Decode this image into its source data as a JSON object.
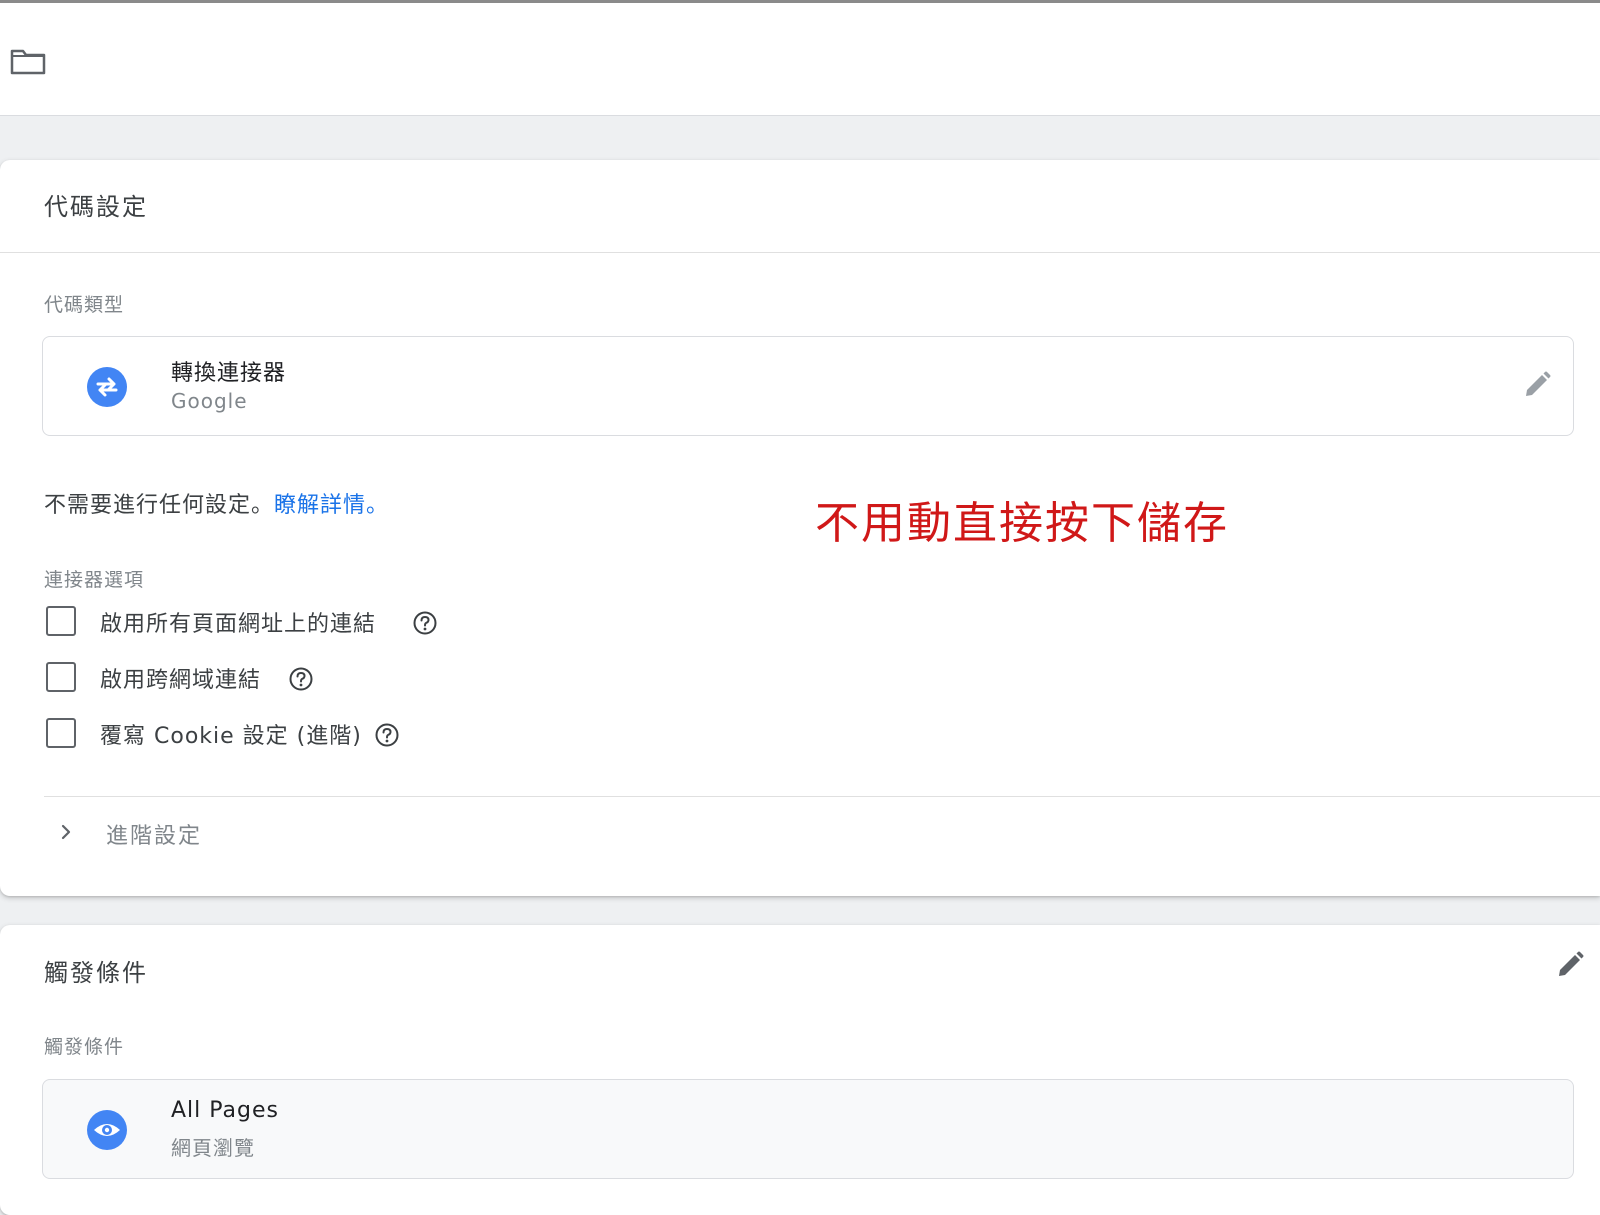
{
  "topbar": {
    "icon": "folder-icon"
  },
  "tag_config": {
    "title": "代碼設定",
    "type_label": "代碼類型",
    "tag_type": {
      "name": "轉換連接器",
      "vendor": "Google",
      "icon": "swap-arrows-icon",
      "icon_color": "#4285f4"
    },
    "no_config_text": "不需要進行任何設定。",
    "learn_more": "瞭解詳情",
    "learn_more_suffix": "。",
    "options_label": "連接器選項",
    "options": [
      {
        "label": "啟用所有頁面網址上的連結",
        "checked": false
      },
      {
        "label": "啟用跨網域連結",
        "checked": false
      },
      {
        "label": "覆寫 Cookie 設定 (進階)",
        "checked": false
      }
    ],
    "advanced_label": "進階設定"
  },
  "annotation": {
    "text": "不用動直接按下儲存",
    "color": "#d01818"
  },
  "triggering": {
    "title": "觸發條件",
    "label": "觸發條件",
    "trigger": {
      "name": "All Pages",
      "type": "網頁瀏覽",
      "icon": "eye-icon",
      "icon_color": "#4285f4"
    }
  },
  "colors": {
    "link": "#1a73e8",
    "accent": "#4285f4",
    "annotation": "#d01818"
  }
}
